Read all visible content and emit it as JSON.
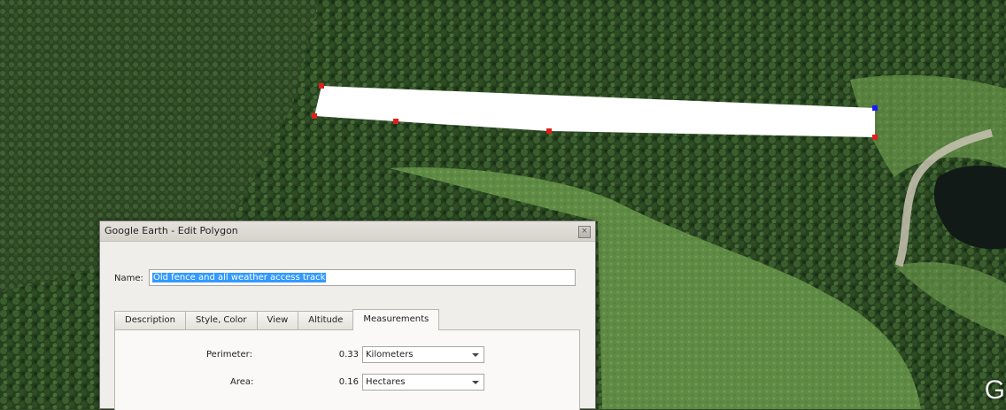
{
  "map": {
    "logo": "G",
    "polygon_color": "#ffffff",
    "vertex_color": "#e02020",
    "selected_vertex_color": "#1a1aff"
  },
  "dialog": {
    "title": "Google Earth - Edit Polygon",
    "close_icon": "close-icon",
    "name_label": "Name:",
    "name_value": "Old fence and all weather access track",
    "tabs": [
      "Description",
      "Style, Color",
      "View",
      "Altitude",
      "Measurements"
    ],
    "active_tab": "Measurements",
    "perimeter": {
      "label": "Perimeter:",
      "value": "0.33",
      "unit": "Kilometers"
    },
    "area": {
      "label": "Area:",
      "value": "0.16",
      "unit": "Hectares"
    }
  }
}
